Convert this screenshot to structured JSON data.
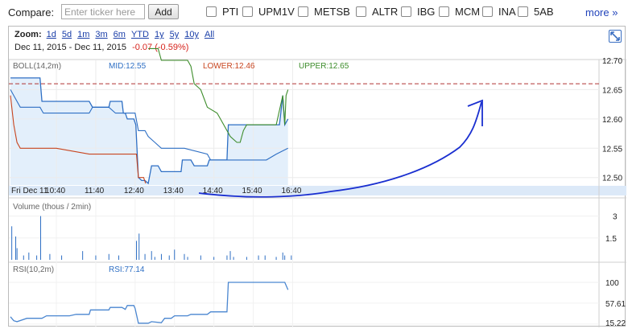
{
  "compare": {
    "label": "Compare:",
    "placeholder": "Enter ticker here",
    "add_label": "Add",
    "tickers": [
      "PTI",
      "UPM1V",
      "METSB",
      "ALTR",
      "IBG",
      "MCM",
      "INA",
      "5AB"
    ],
    "more_label": "more »"
  },
  "zoom": {
    "label": "Zoom:",
    "options": [
      "1d",
      "5d",
      "1m",
      "3m",
      "6m",
      "YTD",
      "1y",
      "5y",
      "10y",
      "All"
    ]
  },
  "range": {
    "text": "Dec 11, 2015 - Dec 11, 2015",
    "change": "-0.07 (-0.59%)"
  },
  "colors": {
    "mid": "#2e6fc4",
    "lower": "#c8451f",
    "upper": "#3c8c2a",
    "fill": "#e3effb",
    "dashed": "#b03434",
    "volume": "#2e6fc4",
    "rsi": "#4a86d0",
    "axis_band": "#dce9f8",
    "annotation": "#1a2fd0"
  },
  "icons": {
    "expand": "expand-icon",
    "checkbox": "checkbox-icon"
  },
  "chart_data": [
    {
      "type": "line",
      "panel": "price",
      "label": "BOLL(14,2m)",
      "readouts": {
        "mid": "MID:12.55",
        "lower": "LOWER:12.46",
        "upper": "UPPER:12.65"
      },
      "y_ticks": [
        "12.65",
        "12.60",
        "12.55",
        "12.50"
      ],
      "y_top_partial": "12.70",
      "ylim": [
        12.49,
        12.7
      ],
      "x_range_minutes": [
        570,
        1030
      ],
      "dashed_reference": 12.66,
      "series": [
        {
          "role": "price",
          "points": [
            [
              570,
              12.67
            ],
            [
              585,
              12.67
            ],
            [
              590,
              12.67
            ],
            [
              615,
              12.67
            ],
            [
              618,
              12.63
            ],
            [
              690,
              12.63
            ],
            [
              695,
              12.62
            ],
            [
              720,
              12.62
            ],
            [
              722,
              12.63
            ],
            [
              740,
              12.63
            ],
            [
              742,
              12.61
            ],
            [
              745,
              12.61
            ],
            [
              748,
              12.6
            ],
            [
              758,
              12.6
            ],
            [
              761,
              12.59
            ],
            [
              765,
              12.5
            ],
            [
              770,
              12.495
            ],
            [
              775,
              12.495
            ],
            [
              780,
              12.49
            ],
            [
              785,
              12.52
            ],
            [
              795,
              12.52
            ],
            [
              800,
              12.51
            ],
            [
              830,
              12.51
            ],
            [
              832,
              12.53
            ],
            [
              845,
              12.53
            ],
            [
              850,
              12.52
            ],
            [
              870,
              12.52
            ],
            [
              873,
              12.53
            ],
            [
              900,
              12.53
            ],
            [
              902,
              12.59
            ],
            [
              920,
              12.59
            ],
            [
              925,
              12.59
            ],
            [
              950,
              12.59
            ],
            [
              975,
              12.59
            ],
            [
              980,
              12.59
            ],
            [
              985,
              12.64
            ],
            [
              988,
              12.59
            ],
            [
              993,
              12.6
            ]
          ]
        },
        {
          "role": "mid",
          "points": [
            [
              570,
              12.65
            ],
            [
              580,
              12.63
            ],
            [
              585,
              12.62
            ],
            [
              600,
              12.62
            ],
            [
              615,
              12.62
            ],
            [
              620,
              12.61
            ],
            [
              690,
              12.61
            ],
            [
              695,
              12.62
            ],
            [
              720,
              12.62
            ],
            [
              730,
              12.61
            ],
            [
              760,
              12.61
            ],
            [
              765,
              12.58
            ],
            [
              775,
              12.58
            ],
            [
              780,
              12.57
            ],
            [
              790,
              12.56
            ],
            [
              800,
              12.55
            ],
            [
              830,
              12.55
            ],
            [
              835,
              12.55
            ],
            [
              870,
              12.54
            ],
            [
              875,
              12.53
            ],
            [
              900,
              12.53
            ],
            [
              905,
              12.53
            ],
            [
              960,
              12.53
            ],
            [
              975,
              12.54
            ],
            [
              993,
              12.55
            ]
          ]
        },
        {
          "role": "lower",
          "points": [
            [
              570,
              12.64
            ],
            [
              575,
              12.59
            ],
            [
              580,
              12.56
            ],
            [
              585,
              12.55
            ],
            [
              600,
              12.55
            ],
            [
              640,
              12.55
            ],
            [
              690,
              12.54
            ],
            [
              720,
              12.54
            ],
            [
              762,
              12.54
            ],
            [
              765,
              12.5
            ],
            [
              773,
              12.5
            ],
            [
              776,
              12.49
            ]
          ]
        },
        {
          "role": "upper",
          "points": [
            [
              780,
              12.72
            ],
            [
              795,
              12.72
            ],
            [
              800,
              12.7
            ],
            [
              830,
              12.7
            ],
            [
              840,
              12.7
            ],
            [
              845,
              12.69
            ],
            [
              850,
              12.66
            ],
            [
              860,
              12.65
            ],
            [
              870,
              12.62
            ],
            [
              885,
              12.61
            ],
            [
              890,
              12.6
            ],
            [
              905,
              12.57
            ],
            [
              915,
              12.56
            ],
            [
              920,
              12.56
            ],
            [
              925,
              12.58
            ],
            [
              930,
              12.59
            ],
            [
              935,
              12.59
            ],
            [
              975,
              12.59
            ],
            [
              985,
              12.64
            ],
            [
              988,
              12.59
            ],
            [
              990,
              12.64
            ],
            [
              993,
              12.65
            ]
          ]
        }
      ],
      "x_ticks": [
        "Fri Dec 11",
        "10:40",
        "11:40",
        "12:40",
        "13:40",
        "14:40",
        "15:40",
        "16:40"
      ]
    },
    {
      "type": "bar",
      "panel": "volume",
      "label": "Volume (thous / 2min)",
      "y_ticks": [
        "3",
        "1.5"
      ],
      "ylim": [
        0,
        3.2
      ],
      "bars": [
        [
          572,
          2.3
        ],
        [
          578,
          1.6
        ],
        [
          580,
          0.8
        ],
        [
          590,
          0.3
        ],
        [
          598,
          0.5
        ],
        [
          610,
          0.3
        ],
        [
          616,
          3.0
        ],
        [
          630,
          0.4
        ],
        [
          648,
          0.3
        ],
        [
          680,
          0.6
        ],
        [
          700,
          0.3
        ],
        [
          720,
          0.4
        ],
        [
          735,
          0.3
        ],
        [
          762,
          1.3
        ],
        [
          766,
          1.8
        ],
        [
          775,
          0.4
        ],
        [
          785,
          0.6
        ],
        [
          790,
          0.2
        ],
        [
          800,
          0.4
        ],
        [
          812,
          0.3
        ],
        [
          820,
          0.7
        ],
        [
          835,
          0.4
        ],
        [
          840,
          0.2
        ],
        [
          860,
          0.3
        ],
        [
          880,
          0.2
        ],
        [
          900,
          0.3
        ],
        [
          905,
          0.6
        ],
        [
          910,
          0.2
        ],
        [
          930,
          0.2
        ],
        [
          948,
          0.3
        ],
        [
          958,
          0.3
        ],
        [
          975,
          0.2
        ],
        [
          985,
          0.5
        ],
        [
          988,
          0.3
        ],
        [
          998,
          0.3
        ]
      ]
    },
    {
      "type": "line",
      "panel": "rsi",
      "label": "RSI(10,2m)",
      "readout": "RSI:77.14",
      "y_ticks": [
        "100",
        "57.61",
        "15.22"
      ],
      "ylim": [
        15,
        100
      ],
      "series": [
        {
          "role": "rsi",
          "points": [
            [
              570,
              30
            ],
            [
              575,
              22
            ],
            [
              580,
              20
            ],
            [
              595,
              27
            ],
            [
              618,
              27
            ],
            [
              625,
              32
            ],
            [
              660,
              32
            ],
            [
              670,
              35
            ],
            [
              690,
              35
            ],
            [
              692,
              44
            ],
            [
              720,
              44
            ],
            [
              722,
              49
            ],
            [
              740,
              49
            ],
            [
              745,
              45
            ],
            [
              748,
              53
            ],
            [
              758,
              53
            ],
            [
              760,
              47
            ],
            [
              765,
              17
            ],
            [
              775,
              17
            ],
            [
              780,
              17
            ],
            [
              785,
              20
            ],
            [
              800,
              18
            ],
            [
              805,
              27
            ],
            [
              815,
              27
            ],
            [
              820,
              32
            ],
            [
              840,
              32
            ],
            [
              845,
              35
            ],
            [
              870,
              35
            ],
            [
              875,
              40
            ],
            [
              900,
              40
            ],
            [
              902,
              100
            ],
            [
              925,
              100
            ],
            [
              950,
              100
            ],
            [
              975,
              100
            ],
            [
              988,
              100
            ],
            [
              993,
              85
            ]
          ]
        }
      ]
    }
  ]
}
